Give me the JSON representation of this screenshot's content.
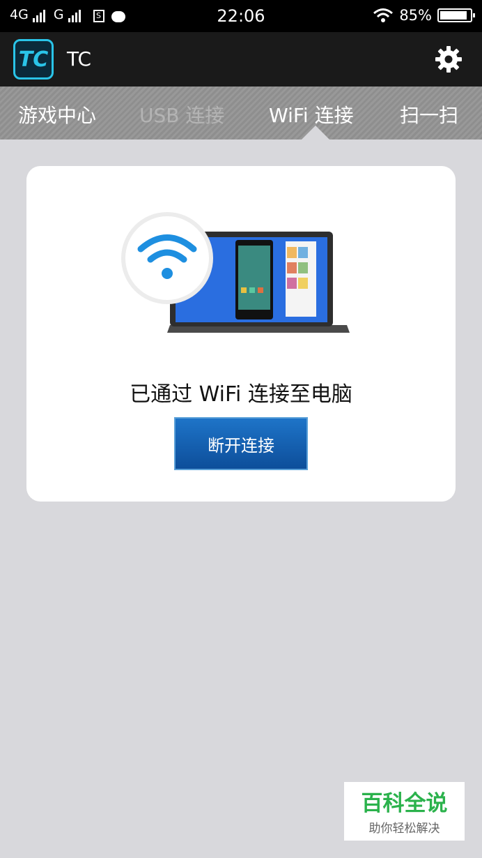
{
  "status_bar": {
    "network_1": "4G",
    "network_2": "G",
    "time": "22:06",
    "battery": "85%"
  },
  "app": {
    "logo_text": "TC",
    "title": "TC",
    "settings_icon": "gear-icon"
  },
  "tabs": [
    {
      "label": "游戏中心",
      "state": "normal"
    },
    {
      "label": "USB 连接",
      "state": "disabled"
    },
    {
      "label": "WiFi 连接",
      "state": "selected"
    },
    {
      "label": "扫一扫",
      "state": "normal"
    }
  ],
  "card": {
    "illustration_icon": "wifi-laptop-illustration",
    "message": "已通过 WiFi 连接至电脑",
    "button_label": "断开连接"
  },
  "watermark": {
    "title": "百科全说",
    "subtitle": "助你轻松解决"
  },
  "colors": {
    "accent_blue": "#1e74c8",
    "wifi_blue": "#1e8fe0",
    "logo_cyan": "#2ac4e8"
  }
}
